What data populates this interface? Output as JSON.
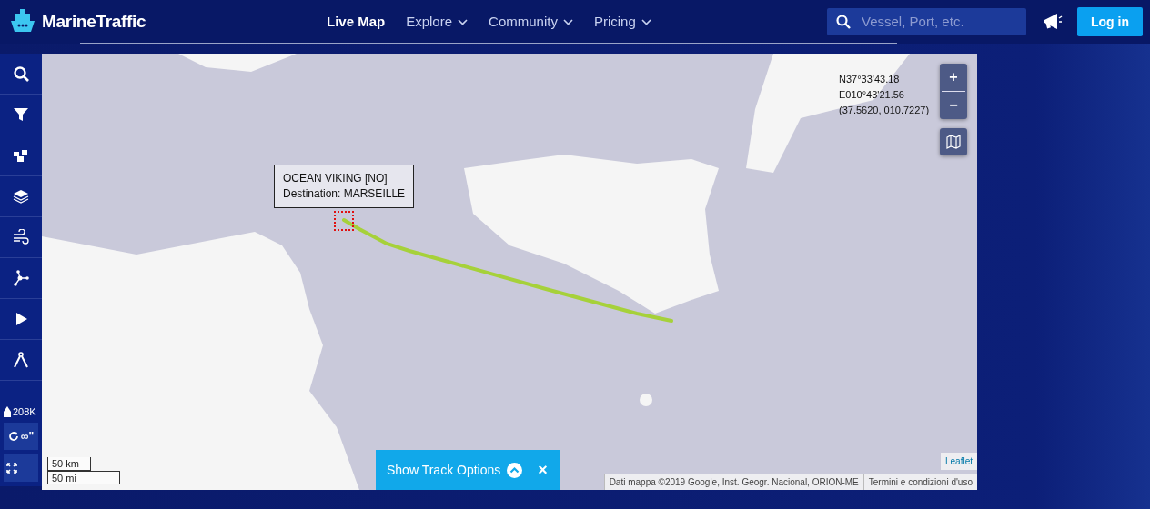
{
  "brand": {
    "name": "MarineTraffic"
  },
  "nav": [
    {
      "label": "Live Map",
      "selected": true,
      "dropdown": false
    },
    {
      "label": "Explore",
      "selected": false,
      "dropdown": true
    },
    {
      "label": "Community",
      "selected": false,
      "dropdown": true
    },
    {
      "label": "Pricing",
      "selected": false,
      "dropdown": true
    }
  ],
  "search": {
    "placeholder": "Vessel, Port, etc."
  },
  "login": {
    "label": "Log in"
  },
  "sidebar": {
    "vessel_count": "208K",
    "refresh_label": "∞\""
  },
  "map": {
    "tooltip": [
      "OCEAN VIKING [NO]",
      "Destination: MARSEILLE"
    ],
    "coordinates": [
      "N37°33'43.18",
      "E010°43'21.56",
      "(37.5620, 010.7227)"
    ],
    "zoom_in": "+",
    "zoom_out": "−",
    "scale": [
      "50 km",
      "50 mi"
    ],
    "attribution": {
      "leaflet": "Leaflet",
      "data": "Dati mappa ©2019 Google, Inst. Geogr. Nacional, ORION-ME",
      "terms": "Termini e condizioni d'uso"
    }
  },
  "track_options": {
    "label": "Show Track Options",
    "close": "×"
  }
}
